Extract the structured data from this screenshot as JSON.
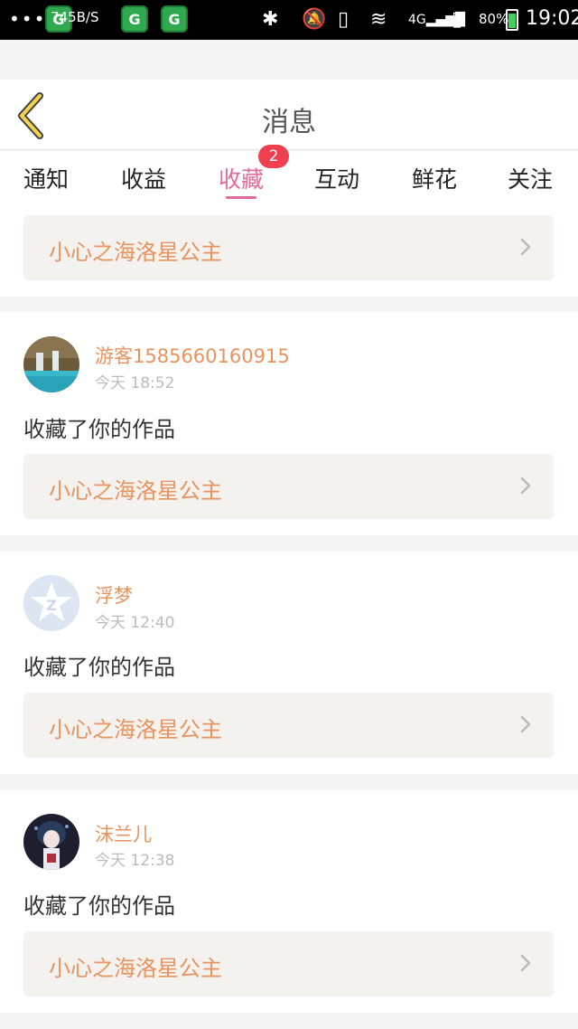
{
  "status_bar": {
    "speed": "745B/S",
    "network": "4G",
    "battery": "80%",
    "time": "19:02"
  },
  "header": {
    "title": "消息"
  },
  "tabs": [
    {
      "label": "通知"
    },
    {
      "label": "收益"
    },
    {
      "label": "收藏",
      "badge": "2",
      "active": true
    },
    {
      "label": "互动"
    },
    {
      "label": "鲜花"
    },
    {
      "label": "关注"
    }
  ],
  "colors": {
    "accent": "#e06a9a",
    "work_title": "#e8935d",
    "badge": "#f0404f"
  },
  "top_item": {
    "work_title": "小心之海洛星公主"
  },
  "items": [
    {
      "username": "游客1585660160915",
      "time": "今天 18:52",
      "action": "收藏了你的作品",
      "work_title": "小心之海洛星公主",
      "avatar_icon": "waterfall-photo-avatar"
    },
    {
      "username": "浮梦",
      "time": "今天 12:40",
      "action": "收藏了你的作品",
      "work_title": "小心之海洛星公主",
      "avatar_icon": "default-star-avatar"
    },
    {
      "username": "沫兰儿",
      "time": "今天 12:38",
      "action": "收藏了你的作品",
      "work_title": "小心之海洛星公主",
      "avatar_icon": "anime-girl-avatar"
    }
  ]
}
